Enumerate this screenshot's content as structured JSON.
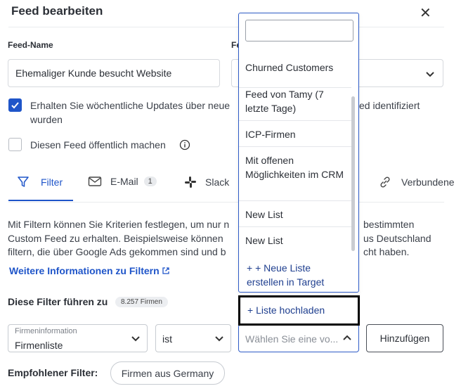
{
  "header": {
    "title": "Feed bearbeiten",
    "close": "✕"
  },
  "feed_name": {
    "label": "Feed-Name",
    "value": "Ehemaliger Kunde besucht Website"
  },
  "feed_type": {
    "label_partial": "Fe"
  },
  "checkboxes": [
    {
      "checked": true,
      "text_left": "Erhalten Sie wöchentliche Updates über neue",
      "text_right": "ed identifiziert",
      "text_line2": "wurden"
    },
    {
      "checked": false,
      "text": "Diesen Feed öffentlich machen"
    }
  ],
  "tabs": [
    {
      "label": "Filter",
      "icon": "filter-icon",
      "active": true
    },
    {
      "label": "E-Mail",
      "icon": "mail-icon",
      "badge": "1"
    },
    {
      "label": "Slack",
      "icon": "slack-icon"
    },
    {
      "label": "Verbundene",
      "icon": "link-icon"
    }
  ],
  "description": {
    "line1_left": "Mit Filtern können Sie Kriterien festlegen, um nur n",
    "line1_right": "bestimmten",
    "line2_left": "Custom Feed zu erhalten. Beispielsweise können",
    "line2_right": "us Deutschland",
    "line3_left": "filtern, die über Google Ads gekommen sind und b",
    "line3_right": "cht haben.",
    "more_link": "Weitere Informationen zu Filtern"
  },
  "filters": {
    "heading": "Diese Filter führen zu",
    "count": "8.257 Firmen"
  },
  "filter_row": {
    "field_label": "Firmeninformation",
    "field_value": "Firmenliste",
    "operator": "ist",
    "value_placeholder": "Wählen Sie eine vo...",
    "add_button": "Hinzufügen"
  },
  "recommended": {
    "label": "Empfohlener Filter:",
    "chip": "Firmen aus Germany"
  },
  "dropdown": {
    "search_value": "",
    "items": [
      "Churned Customers",
      "Feed von Tamy (7 letzte Tage)",
      "ICP-Firmen",
      "Mit offenen Möglichkeiten im CRM",
      "New List",
      "New List"
    ],
    "new_list": "+ + Neue Liste erstellen in Target",
    "upload": "+ Liste hochladen"
  },
  "colors": {
    "accent": "#1f55c9",
    "text": "#2b2f36",
    "border": "#d6d9de"
  }
}
